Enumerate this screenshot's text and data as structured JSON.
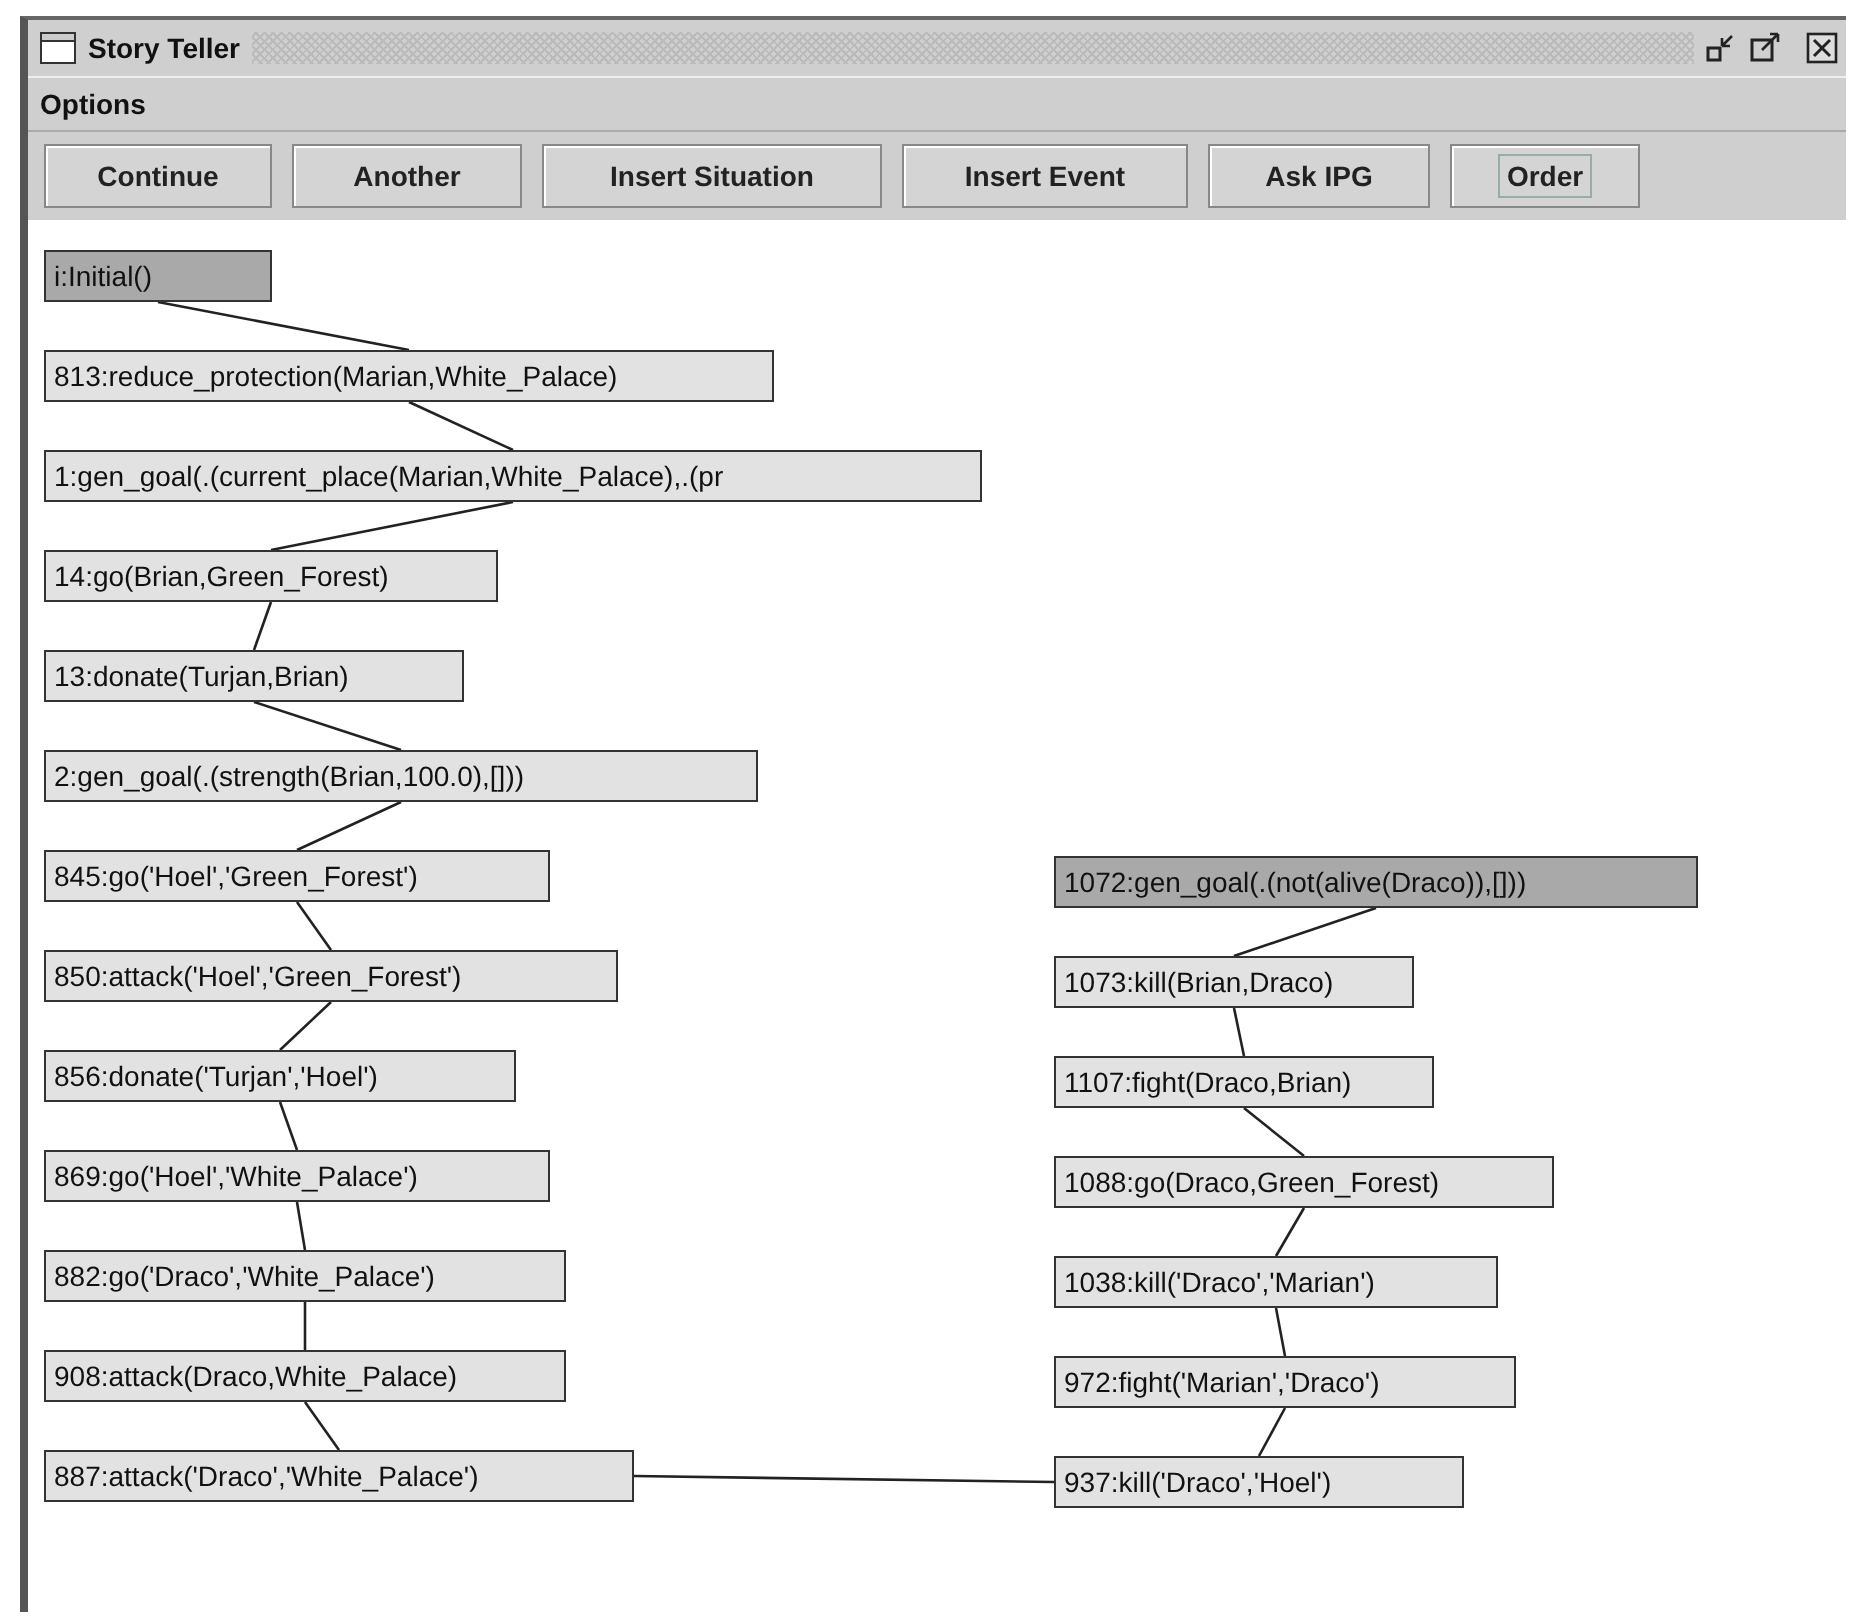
{
  "window": {
    "title": "Story Teller"
  },
  "menu": [
    {
      "label": "Options"
    }
  ],
  "toolbar": [
    {
      "label": "Continue",
      "focused": false
    },
    {
      "label": "Another",
      "focused": false
    },
    {
      "label": "Insert Situation",
      "focused": false
    },
    {
      "label": "Insert Event",
      "focused": false
    },
    {
      "label": "Ask IPG",
      "focused": false
    },
    {
      "label": "Order",
      "focused": true
    }
  ],
  "graph": {
    "columns": [
      {
        "nodes": [
          {
            "label": "i:Initial()",
            "highlighted": true
          },
          {
            "label": "813:reduce_protection(Marian,White_Palace)",
            "highlighted": false
          },
          {
            "label": "1:gen_goal(.(current_place(Marian,White_Palace),.(pr",
            "highlighted": false
          },
          {
            "label": "14:go(Brian,Green_Forest)",
            "highlighted": false
          },
          {
            "label": "13:donate(Turjan,Brian)",
            "highlighted": false
          },
          {
            "label": "2:gen_goal(.(strength(Brian,100.0),[]))",
            "highlighted": false
          },
          {
            "label": "845:go('Hoel','Green_Forest')",
            "highlighted": false
          },
          {
            "label": "850:attack('Hoel','Green_Forest')",
            "highlighted": false
          },
          {
            "label": "856:donate('Turjan','Hoel')",
            "highlighted": false
          },
          {
            "label": "869:go('Hoel','White_Palace')",
            "highlighted": false
          },
          {
            "label": "882:go('Draco','White_Palace')",
            "highlighted": false
          },
          {
            "label": "908:attack(Draco,White_Palace)",
            "highlighted": false
          },
          {
            "label": "887:attack('Draco','White_Palace')",
            "highlighted": false
          }
        ]
      },
      {
        "nodes": [
          {
            "label": "1072:gen_goal(.(not(alive(Draco)),[]))",
            "highlighted": true
          },
          {
            "label": "1073:kill(Brian,Draco)",
            "highlighted": false
          },
          {
            "label": "1107:fight(Draco,Brian)",
            "highlighted": false
          },
          {
            "label": "1088:go(Draco,Green_Forest)",
            "highlighted": false
          },
          {
            "label": "1038:kill('Draco','Marian')",
            "highlighted": false
          },
          {
            "label": "972:fight('Marian','Draco')",
            "highlighted": false
          },
          {
            "label": "937:kill('Draco','Hoel')",
            "highlighted": false
          }
        ]
      }
    ],
    "link_column_ends": true
  }
}
